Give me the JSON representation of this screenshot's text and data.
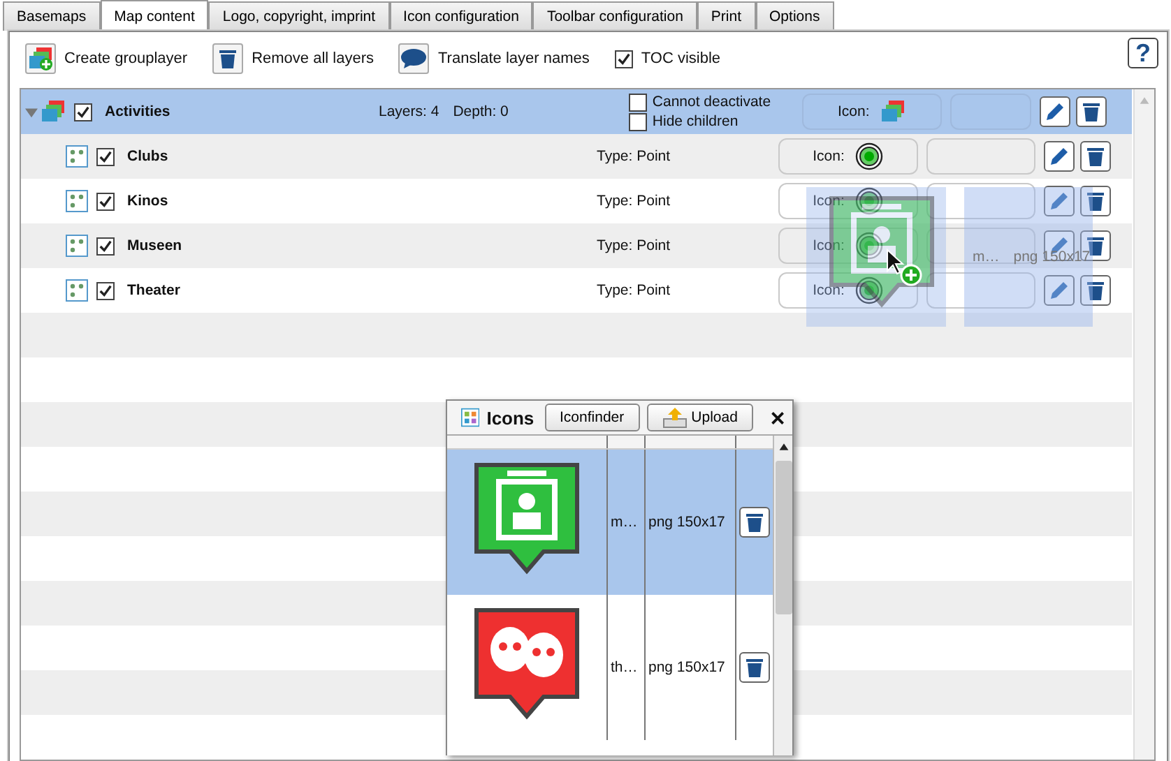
{
  "tabs": [
    {
      "label": "Basemaps",
      "selected": false
    },
    {
      "label": "Map content",
      "selected": true
    },
    {
      "label": "Logo, copyright, imprint",
      "selected": false
    },
    {
      "label": "Icon configuration",
      "selected": false
    },
    {
      "label": "Toolbar configuration",
      "selected": false
    },
    {
      "label": "Print",
      "selected": false
    },
    {
      "label": "Options",
      "selected": false
    }
  ],
  "toolbar": {
    "buttons": [
      {
        "kind": "add-group",
        "label": "Create grouplayer"
      },
      {
        "kind": "trash",
        "label": "Remove all layers"
      },
      {
        "kind": "speech",
        "label": "Translate layer names"
      }
    ],
    "toc_visible": {
      "label": "TOC visible",
      "checked": true
    },
    "help": "?"
  },
  "group": {
    "name": "Activities",
    "expanded": true,
    "checked": true,
    "selected": true,
    "layers": "Layers: 4",
    "depth": "Depth: 0",
    "options": [
      {
        "label": "Cannot deactivate",
        "checked": false
      },
      {
        "label": "Hide children",
        "checked": false
      }
    ],
    "icon_label": "Icon:",
    "children": [
      {
        "name": "Clubs",
        "checked": true,
        "type": "Type: Point",
        "icon_label": "Icon:"
      },
      {
        "name": "Kinos",
        "checked": true,
        "type": "Type: Point",
        "icon_label": "Icon:"
      },
      {
        "name": "Museen",
        "checked": true,
        "type": "Type: Point",
        "icon_label": "Icon:"
      },
      {
        "name": "Theater",
        "checked": true,
        "type": "Type: Point",
        "icon_label": "Icon:"
      }
    ]
  },
  "drag_preview": {
    "name": "m…",
    "format": "png 150x17"
  },
  "icons_dialog": {
    "title": "Icons",
    "buttons": [
      {
        "kind": "plain",
        "label": "Iconfinder"
      },
      {
        "kind": "upload",
        "label": "Upload"
      }
    ],
    "rows": [
      {
        "name": "m…",
        "format": "png 150x17",
        "color": "#2fbf3f",
        "selected": true
      },
      {
        "name": "th…",
        "format": "png 150x17",
        "color": "#ee3030",
        "selected": false
      }
    ]
  }
}
